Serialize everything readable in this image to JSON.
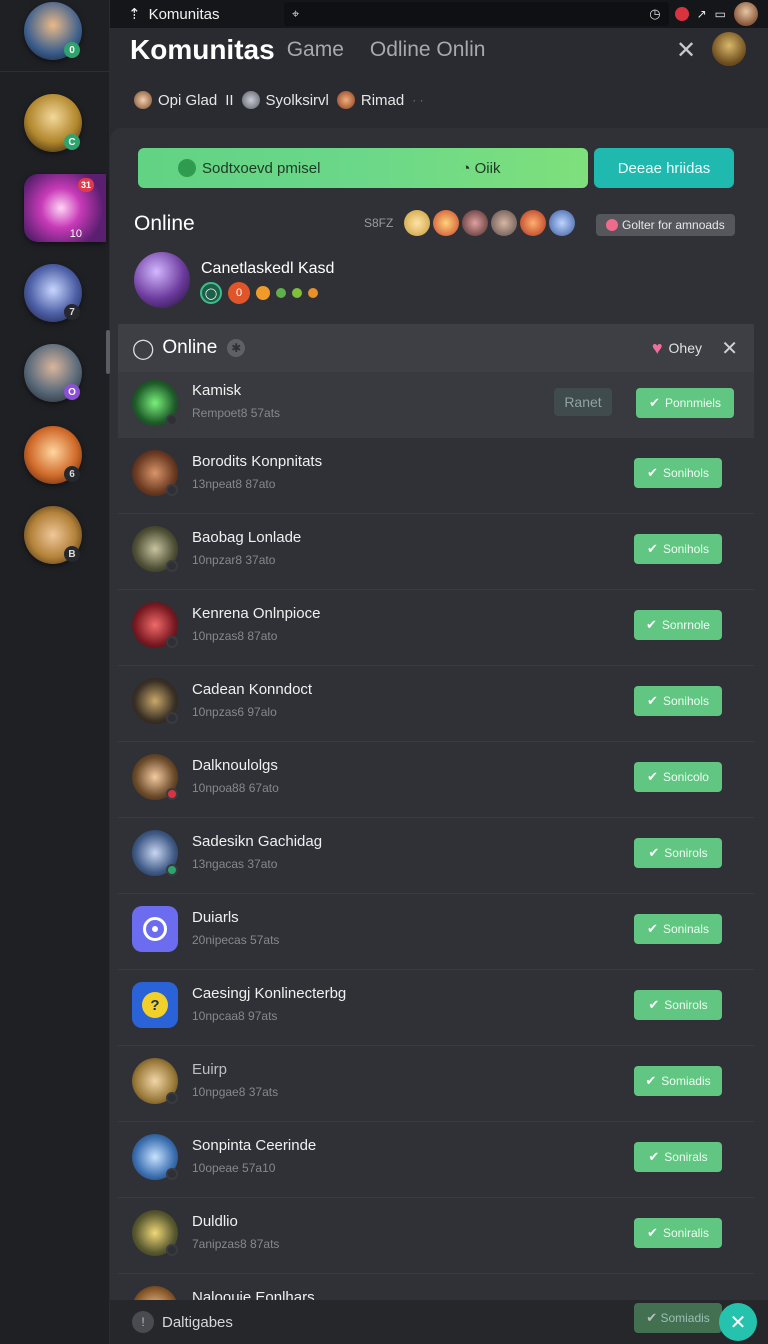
{
  "statusbar": {
    "app_name": "Komunitas",
    "center_icon": "⌖",
    "clock_icon": "◷"
  },
  "header": {
    "title": "Komunitas",
    "tab_game": "Game",
    "tab_online": "Odline Onlin",
    "close_glyph": "✕"
  },
  "userrow": {
    "user1": "Opi Glad",
    "divider": "II",
    "user2": "Syolksirvl",
    "user3": "Rimad",
    "more": "· ·"
  },
  "sidebar": {
    "servers": [
      {
        "badge": "0",
        "count": "",
        "notif": ""
      },
      {
        "badge": "C",
        "count": "",
        "notif": ""
      },
      {
        "badge": "",
        "count": "10",
        "notif": "31"
      },
      {
        "badge": "7",
        "count": "",
        "notif": ""
      },
      {
        "badge": "O",
        "count": "",
        "notif": ""
      },
      {
        "badge": "6",
        "count": "",
        "notif": ""
      },
      {
        "badge": "B",
        "count": "",
        "notif": ""
      }
    ]
  },
  "actions": {
    "main_left": "Sodtxoevd pmisel",
    "main_right": "Oiik",
    "secondary": "Deeae hriidas"
  },
  "online": {
    "heading": "Online",
    "meta": "S8FZ",
    "gather": "Golter for amnoads"
  },
  "featured": {
    "name": "Canetlaskedl Kasd",
    "badge_number": "0"
  },
  "section": {
    "title": "Online",
    "other": "Ohey",
    "close_glyph": "✕"
  },
  "rows": [
    {
      "name": "Kamisk",
      "sub": "Rempoet8 57ats",
      "action": "Ponnmiels",
      "secondary": "Ranet",
      "color": "#1f5e2a"
    },
    {
      "name": "Borodits Konpnitats",
      "sub": "13npeat8 87ato",
      "action": "Sonihols",
      "color": "#6b3a22"
    },
    {
      "name": "Baobag Lonlade",
      "sub": "10npzar8 37ato",
      "action": "Sonihols",
      "color": "#4f5036"
    },
    {
      "name": "Kenrena Onlnpioce",
      "sub": "10npzas8 87ato",
      "action": "Sonrnole",
      "color": "#7a1a22"
    },
    {
      "name": "Cadean Konndoct",
      "sub": "10npzas6 97alo",
      "action": "Sonihols",
      "color": "#3c3226"
    },
    {
      "name": "Dalknoulolgs",
      "sub": "10npoa88 67ato",
      "action": "Sonicolo",
      "color": "#6a4a2a"
    },
    {
      "name": "Sadesikn Gachidag",
      "sub": "13ngacas 37ato",
      "action": "Sonirols",
      "color": "#3f5a86"
    },
    {
      "name": "Duiarls",
      "sub": "20nipecas 57ats",
      "action": "Soninals",
      "color": "#6b6cf0"
    },
    {
      "name": "Caesingj Konlinecterbg",
      "sub": "10npcaa8 97ats",
      "action": "Sonirols",
      "color": "#2a63d8"
    },
    {
      "name": "Euirp",
      "sub": "10npgae8 37ats",
      "action": "Somiadis",
      "color": "#9a7a3a"
    },
    {
      "name": "Sonpinta Ceerinde",
      "sub": "10opeae 57a10",
      "action": "Sonirals",
      "color": "#3b6fb0"
    },
    {
      "name": "Duldlio",
      "sub": "7anipzas8 87ats",
      "action": "Soniralis",
      "color": "#5a5a30"
    }
  ],
  "partial_row": {
    "name": "Naloouie Eonlhars"
  },
  "bottombar": {
    "label": "Daltigabes",
    "fab_glyph": "✕",
    "ghost_action": "Somiadis"
  }
}
